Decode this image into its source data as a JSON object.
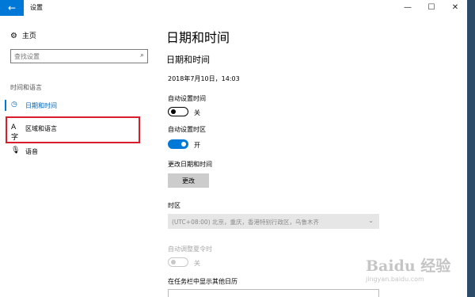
{
  "window": {
    "title": "设置"
  },
  "sidebar": {
    "home_label": "主页",
    "search_placeholder": "查找设置",
    "section_label": "时间和语言",
    "items": [
      {
        "label": "日期和时间",
        "icon": "calendar-clock-icon",
        "selected": true
      },
      {
        "label": "区域和语言",
        "icon": "region-language-icon",
        "selected": false,
        "highlighted": true
      },
      {
        "label": "语音",
        "icon": "microphone-icon",
        "selected": false
      }
    ]
  },
  "main": {
    "page_title": "日期和时间",
    "section_title": "日期和时间",
    "current_datetime": "2018年7月10日，14:03",
    "auto_time": {
      "label": "自动设置时间",
      "state": "关",
      "on": false
    },
    "auto_timezone": {
      "label": "自动设置时区",
      "state": "开",
      "on": true
    },
    "change_datetime": {
      "label": "更改日期和时间",
      "button": "更改"
    },
    "timezone": {
      "label": "时区",
      "value": "(UTC+08:00) 北京，重庆，香港特别行政区，乌鲁木齐"
    },
    "dst": {
      "label": "自动调整夏令时",
      "state": "关",
      "on": false,
      "enabled": false
    },
    "calendar_label": "在任务栏中显示其他日历"
  },
  "watermark": {
    "logo": "Baidu 经验",
    "url": "jingyan.baidu.com"
  },
  "colors": {
    "accent": "#0078d7",
    "highlight_border": "#d81e2a"
  }
}
